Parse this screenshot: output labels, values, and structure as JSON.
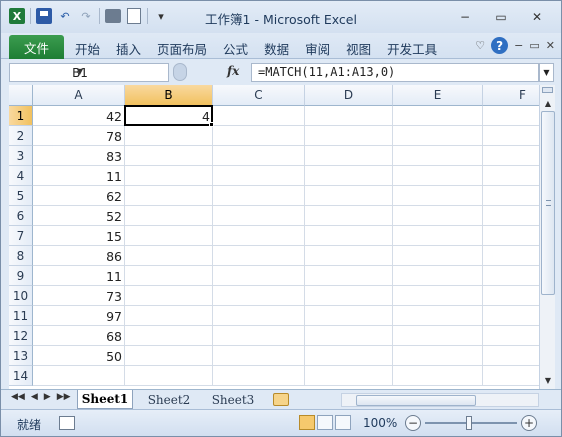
{
  "window": {
    "title": "工作簿1 - Microsoft Excel",
    "controls": {
      "minimize": "−",
      "maximize": "▭",
      "close": "✕"
    }
  },
  "quick_access": {
    "app_icon": "X",
    "undo_icon": "↶",
    "redo_icon": "↷",
    "more": "▾"
  },
  "ribbon": {
    "file_tab": "文件",
    "tabs": [
      "开始",
      "插入",
      "页面布局",
      "公式",
      "数据",
      "审阅",
      "视图",
      "开发工具"
    ],
    "collapse_icon": "♡",
    "help": "?",
    "doc_controls": {
      "minimize": "−",
      "restore": "▭",
      "close": "✕"
    }
  },
  "formula_bar": {
    "name_box": "B1",
    "fx_label": "fx",
    "formula": "=MATCH(11,A1:A13,0)"
  },
  "columns": [
    "A",
    "B",
    "C",
    "D",
    "E",
    "F"
  ],
  "rows": [
    "1",
    "2",
    "3",
    "4",
    "5",
    "6",
    "7",
    "8",
    "9",
    "10",
    "11",
    "12",
    "13",
    "14"
  ],
  "column_a_values": [
    "42",
    "78",
    "83",
    "11",
    "62",
    "52",
    "15",
    "86",
    "11",
    "73",
    "97",
    "68",
    "50",
    ""
  ],
  "cell_b1": "4",
  "selected": {
    "column": "B",
    "row": "1"
  },
  "sheet_tabs": {
    "nav": [
      "◀◀",
      "◀",
      "▶",
      "▶▶"
    ],
    "tabs": [
      "Sheet1",
      "Sheet2",
      "Sheet3"
    ],
    "active": "Sheet1"
  },
  "status_bar": {
    "ready": "就绪",
    "zoom": "100%",
    "zoom_minus": "−",
    "zoom_plus": "+"
  }
}
